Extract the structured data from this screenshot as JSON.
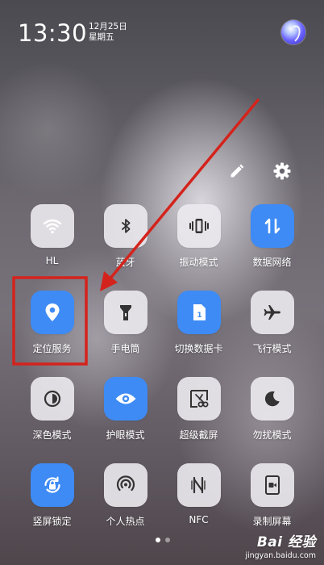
{
  "status": {
    "time": "13:30",
    "date_line1": "12月25日",
    "date_line2": "星期五"
  },
  "header_icons": {
    "assistant": "assistant-orb-icon",
    "edit": "pencil-icon",
    "settings": "gear-icon"
  },
  "tiles": [
    {
      "label": "HL",
      "icon": "wifi-icon",
      "on": true
    },
    {
      "label": "蓝牙",
      "icon": "bluetooth-icon",
      "on": false
    },
    {
      "label": "振动模式",
      "icon": "vibrate-icon",
      "on": false
    },
    {
      "label": "数据网络",
      "icon": "mobile-data-icon",
      "on": true
    },
    {
      "label": "定位服务",
      "icon": "location-icon",
      "on": true
    },
    {
      "label": "手电筒",
      "icon": "flashlight-icon",
      "on": false
    },
    {
      "label": "切换数据卡",
      "icon": "sim-card-icon",
      "on": true
    },
    {
      "label": "飞行模式",
      "icon": "airplane-icon",
      "on": false
    },
    {
      "label": "深色模式",
      "icon": "dark-mode-icon",
      "on": false
    },
    {
      "label": "护眼模式",
      "icon": "eye-icon",
      "on": true
    },
    {
      "label": "超级截屏",
      "icon": "screenshot-icon",
      "on": false
    },
    {
      "label": "勿扰模式",
      "icon": "moon-icon",
      "on": false
    },
    {
      "label": "竖屏锁定",
      "icon": "rotation-lock-icon",
      "on": true
    },
    {
      "label": "个人热点",
      "icon": "hotspot-icon",
      "on": false
    },
    {
      "label": "NFC",
      "icon": "nfc-icon",
      "on": false
    },
    {
      "label": "录制屏幕",
      "icon": "screen-record-icon",
      "on": false
    }
  ],
  "pager": {
    "pages": 2,
    "current": 1
  },
  "watermark": {
    "logo": "Bai 经验",
    "url": "jingyan.baidu.com"
  },
  "colors": {
    "tile_on": "#3e8bf5",
    "tile_off": "#eceaee",
    "annotation": "#d4231c"
  }
}
